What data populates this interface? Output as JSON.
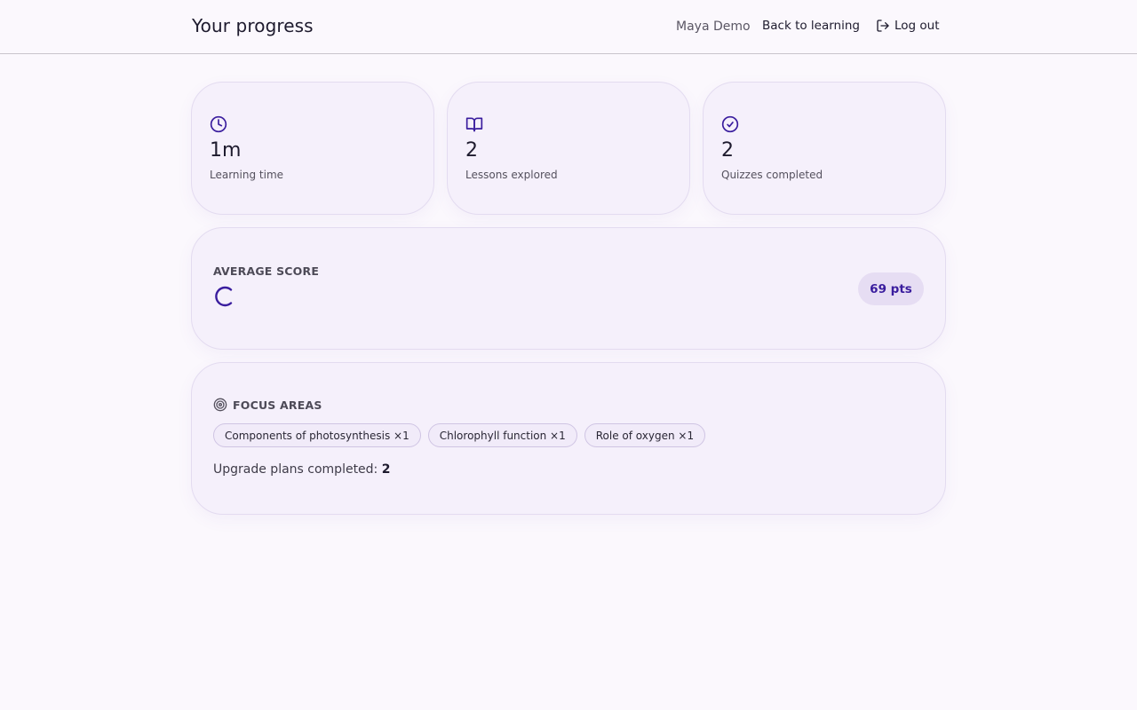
{
  "header": {
    "title": "Your progress",
    "user_name": "Maya Demo",
    "back_label": "Back to learning",
    "logout_label": "Log out"
  },
  "stats": [
    {
      "icon": "clock-icon",
      "value": "1m",
      "label": "Learning time"
    },
    {
      "icon": "book-open-icon",
      "value": "2",
      "label": "Lessons explored"
    },
    {
      "icon": "check-circle-icon",
      "value": "2",
      "label": "Quizzes completed"
    }
  ],
  "average_score": {
    "label": "AVERAGE SCORE",
    "points": "69 pts"
  },
  "focus": {
    "label": "FOCUS AREAS",
    "chips": [
      "Components of photosynthesis ×1",
      "Chlorophyll function ×1",
      "Role of oxygen ×1"
    ],
    "upgrade_label": "Upgrade plans completed:",
    "upgrade_count": "2"
  },
  "colors": {
    "accent": "#3a1d9e",
    "background": "#fbf8fd",
    "card": "#f5f0fb"
  }
}
